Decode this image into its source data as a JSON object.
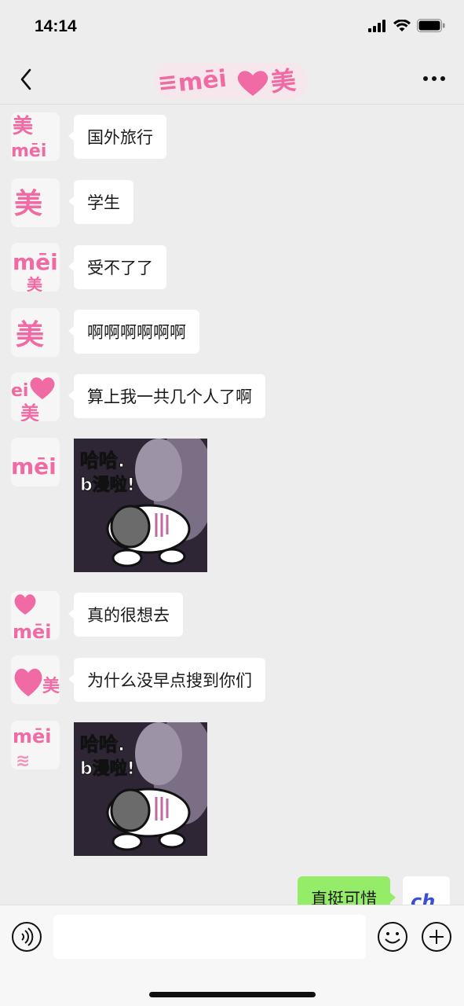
{
  "status": {
    "time": "14:14"
  },
  "nav": {
    "title_sticker": {
      "text_1": "mēi",
      "text_2": "美",
      "icon": "heart-icon"
    }
  },
  "avatar_sticker": {
    "text_1": "美",
    "text_2": "mēi",
    "icon": "heart-icon"
  },
  "messages": [
    {
      "text": "国外旅行"
    },
    {
      "text": "学生"
    },
    {
      "text": "受不了了"
    },
    {
      "text": "啊啊啊啊啊啊"
    },
    {
      "text": "算上我一共几个人了啊"
    },
    {
      "sticker_text_1": "哈哈.",
      "sticker_text_2": "b漫啦!"
    },
    {
      "text": "真的很想去"
    },
    {
      "text": "为什么没早点搜到你们"
    },
    {
      "sticker_text_1": "哈哈.",
      "sticker_text_2": "b漫啦!"
    }
  ],
  "outgoing": {
    "text": "直挺可惜",
    "avatar_text": "ch"
  },
  "input": {
    "placeholder": ""
  },
  "colors": {
    "bg": "#ededed",
    "bubble_in": "#ffffff",
    "bubble_out": "#95ec69",
    "accent_pink": "#f06aa3"
  }
}
